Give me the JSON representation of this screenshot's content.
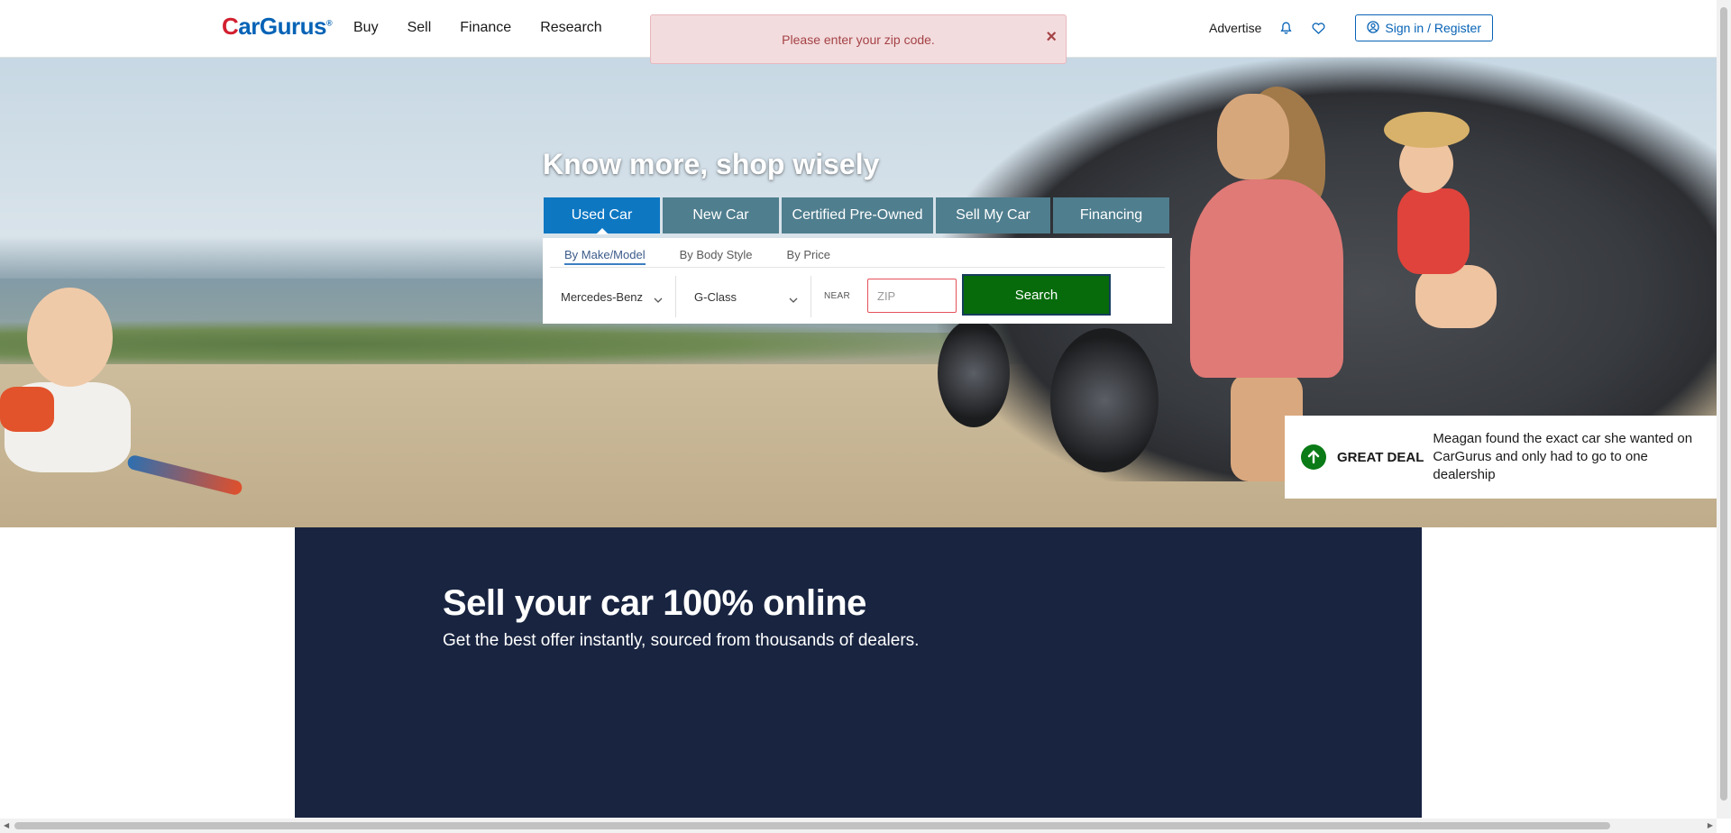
{
  "header": {
    "logo": "CarGurus",
    "nav": [
      "Buy",
      "Sell",
      "Finance",
      "Research"
    ],
    "advertise": "Advertise",
    "signin": "Sign in / Register"
  },
  "toast": {
    "message": "Please enter your zip code.",
    "close": "×"
  },
  "hero": {
    "title": "Know more, shop wisely",
    "tabs": [
      "Used Car",
      "New Car",
      "Certified Pre-Owned",
      "Sell My Car",
      "Financing"
    ],
    "active_tab": "Used Car",
    "subtabs": [
      "By Make/Model",
      "By Body Style",
      "By Price"
    ],
    "active_subtab": "By Make/Model",
    "make": "Mercedes-Benz",
    "model": "G-Class",
    "near_label": "NEAR",
    "zip_placeholder": "ZIP",
    "search_button": "Search"
  },
  "deal": {
    "label": "GREAT DEAL",
    "text": "Meagan found the exact car she wanted on CarGurus and only had to go to one dealership"
  },
  "sell_banner": {
    "title": "Sell your car 100% online",
    "subtitle": "Get the best offer instantly, sourced from thousands of dealers."
  },
  "icons": {
    "bell": "bell-icon",
    "heart": "heart-icon",
    "user": "user-circle-icon",
    "chevron": "chevron-down-icon",
    "up_arrow": "arrow-up-icon"
  },
  "colors": {
    "brand_blue": "#0763b6",
    "active_tab": "#0d77c2",
    "tab": "#4f7e8e",
    "search_green": "#076b0b",
    "banner_navy": "#182440",
    "toast_bg": "#f3dcde",
    "toast_text": "#a44245"
  }
}
